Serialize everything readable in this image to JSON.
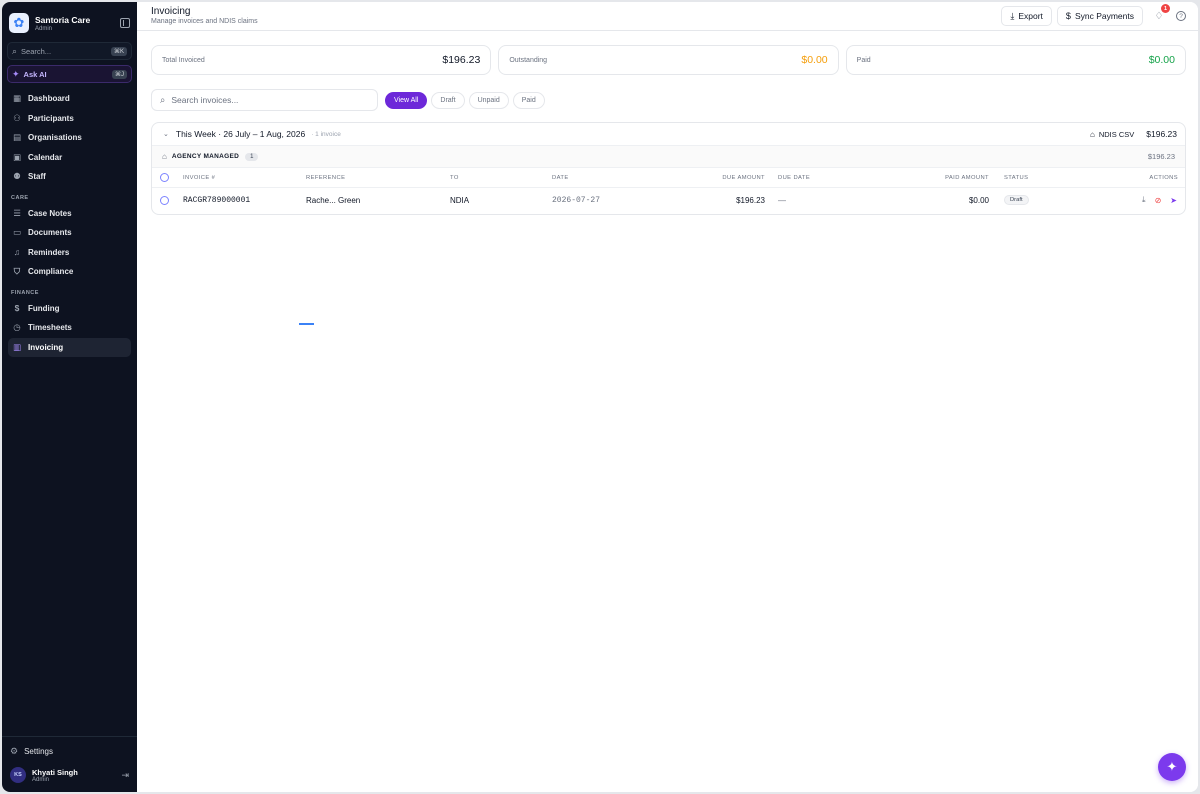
{
  "sidebar": {
    "brand_name": "Santoria Care",
    "brand_role": "Admin",
    "search_placeholder": "Search...",
    "search_shortcut": "⌘K",
    "ask_ai_label": "Ask AI",
    "ask_ai_shortcut": "⌘J",
    "main_items": [
      {
        "label": "Dashboard",
        "icon": "dashboard-icon"
      },
      {
        "label": "Participants",
        "icon": "users-icon"
      },
      {
        "label": "Organisations",
        "icon": "building-icon"
      },
      {
        "label": "Calendar",
        "icon": "calendar-icon"
      },
      {
        "label": "Staff",
        "icon": "staff-icon"
      }
    ],
    "care_label": "CARE",
    "care_items": [
      {
        "label": "Case Notes",
        "icon": "notes-icon"
      },
      {
        "label": "Documents",
        "icon": "folder-icon"
      },
      {
        "label": "Reminders",
        "icon": "bell-icon"
      },
      {
        "label": "Compliance",
        "icon": "shield-icon"
      }
    ],
    "finance_label": "FINANCE",
    "finance_items": [
      {
        "label": "Funding",
        "icon": "dollar-icon"
      },
      {
        "label": "Timesheets",
        "icon": "clock-icon"
      },
      {
        "label": "Invoicing",
        "icon": "invoice-icon",
        "active": true
      }
    ],
    "settings_label": "Settings",
    "user": {
      "initials": "KS",
      "name": "Khyati Singh",
      "role": "Admin"
    }
  },
  "header": {
    "title": "Invoicing",
    "subtitle": "Manage invoices and NDIS claims",
    "export_label": "Export",
    "sync_label": "Sync Payments",
    "notification_count": "1"
  },
  "stats": [
    {
      "label": "Total Invoiced",
      "value": "$196.23"
    },
    {
      "label": "Outstanding",
      "value": "$0.00"
    },
    {
      "label": "Paid",
      "value": "$0.00"
    }
  ],
  "filters": {
    "search_placeholder": "Search invoices...",
    "pills": [
      "View All",
      "Draft",
      "Unpaid",
      "Paid"
    ]
  },
  "group": {
    "title": "This Week · 26 July – 1 Aug, 2026",
    "count": "· 1 invoice",
    "ndis_csv_label": "NDIS CSV",
    "total": "$196.23",
    "agency_label": "AGENCY MANAGED",
    "agency_count": "1",
    "agency_total": "$196.23"
  },
  "table": {
    "columns": [
      "INVOICE #",
      "REFERENCE",
      "TO",
      "DATE",
      "DUE AMOUNT",
      "DUE DATE",
      "PAID AMOUNT",
      "STATUS",
      "ACTIONS"
    ],
    "rows": [
      {
        "invoice": "RACGR789000001",
        "reference": "Rache... Green",
        "to": "NDIA",
        "date": "2026-07-27",
        "due_amount": "$196.23",
        "due_date": "—",
        "paid_amount": "$0.00",
        "status": "Draft"
      }
    ]
  },
  "colors": {
    "accent": "#6d28d9",
    "sidebar_bg": "#0d1220",
    "outstanding": "#f59e0b",
    "paid": "#16a34a"
  }
}
